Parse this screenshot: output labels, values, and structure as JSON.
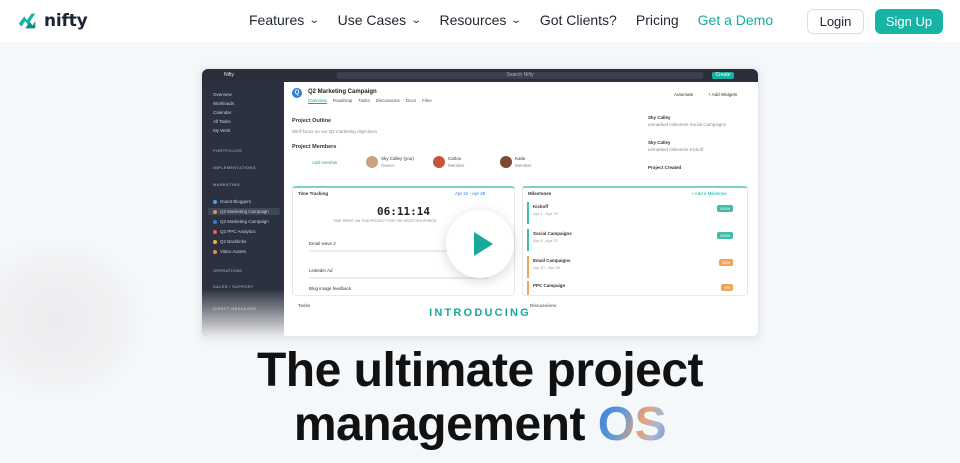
{
  "brand": {
    "name": "nifty",
    "accent": "#17b3a5"
  },
  "nav": {
    "links": [
      {
        "label": "Features",
        "has_dropdown": true
      },
      {
        "label": "Use Cases",
        "has_dropdown": true
      },
      {
        "label": "Resources",
        "has_dropdown": true
      },
      {
        "label": "Got Clients?",
        "has_dropdown": false
      },
      {
        "label": "Pricing",
        "has_dropdown": false
      },
      {
        "label": "Get a Demo",
        "has_dropdown": false
      }
    ],
    "chevron": "⌄",
    "login_label": "Login",
    "signup_label": "Sign Up"
  },
  "hero": {
    "title_line1": "The ultimate project",
    "title_line2_prefix": "management ",
    "title_line2_highlight": "OS",
    "video_label": "INTRODUCING",
    "play_icon": "play-icon"
  },
  "preview": {
    "app_name": "Nifty",
    "search_placeholder": "Search Nifty",
    "create_label": "Create",
    "sidebar": {
      "items": [
        "Overview",
        "Workloads",
        "Calendar",
        "All Tasks",
        "My Work"
      ],
      "portfolio_head": "PORTFOLIOS",
      "implementations_head": "IMPLEMENTATIONS",
      "marketing_head": "MARKETING",
      "marketing_items": [
        "Guest Bloggers",
        "Q2 Marketing Campaign",
        "Q2 Marketing Campaign",
        "Q2 PPC Analytics",
        "Q2 Backlinks",
        "Video Assets"
      ],
      "operations_head": "OPERATIONS",
      "sales_head": "SALES / SUPPORT",
      "dm_head": "DIRECT MESSAGES"
    },
    "project": {
      "badge": "Q",
      "title": "Q2 Marketing Campaign",
      "tabs": [
        "Overview",
        "Roadmap",
        "Tasks",
        "Discussions",
        "Docs",
        "Files"
      ],
      "automate_label": "Automate",
      "add_widgets_label": "+ Add Widgets",
      "outline_head": "Project Outline",
      "outline_text": "We'll focus on our Q2 marketing objectives",
      "members_head": "Project Members",
      "add_member_label": "Add member",
      "members": [
        {
          "name": "Sky Calley (you)",
          "role": "Owner"
        },
        {
          "name": "Carlos",
          "role": "Member"
        },
        {
          "name": "Katie",
          "role": "Member"
        }
      ],
      "activity": [
        {
          "title": "Sky Calley",
          "text": "unmarked milestone Social Campaigns"
        },
        {
          "title": "Sky Calley",
          "text": "unmarked milestone Kickoff"
        },
        {
          "title": "Project Created",
          "text": ""
        }
      ],
      "time_tracking": {
        "head": "Time Tracking",
        "range": "Apr 22 - Apr 28",
        "total": "06:11:14",
        "caption": "TIME SPENT ON THIS PROJECT FOR THE SELECTED PERIOD",
        "entries": [
          "Email wave 2",
          "LinkedIn Ad",
          "Blog image feedback"
        ]
      },
      "milestones": {
        "head": "Milestones",
        "add_label": "+ Add a Milestone",
        "rows": [
          {
            "name": "Kickoff",
            "dates": "Apr 1 - Apr 19",
            "pct": "100%",
            "color": "#3fbda8"
          },
          {
            "name": "Social Campaigns",
            "dates": "Apr 8 - Apr 22",
            "pct": "100%",
            "color": "#3fbda8"
          },
          {
            "name": "Email Campaigns",
            "dates": "Apr 10 - Apr 25",
            "pct": "40%",
            "color": "#f0a35a"
          },
          {
            "name": "PPC Campaign",
            "dates": "",
            "pct": "0%",
            "color": "#f0a35a"
          }
        ]
      },
      "tasks_head": "Tasks",
      "discussions_head": "Discussions"
    }
  }
}
